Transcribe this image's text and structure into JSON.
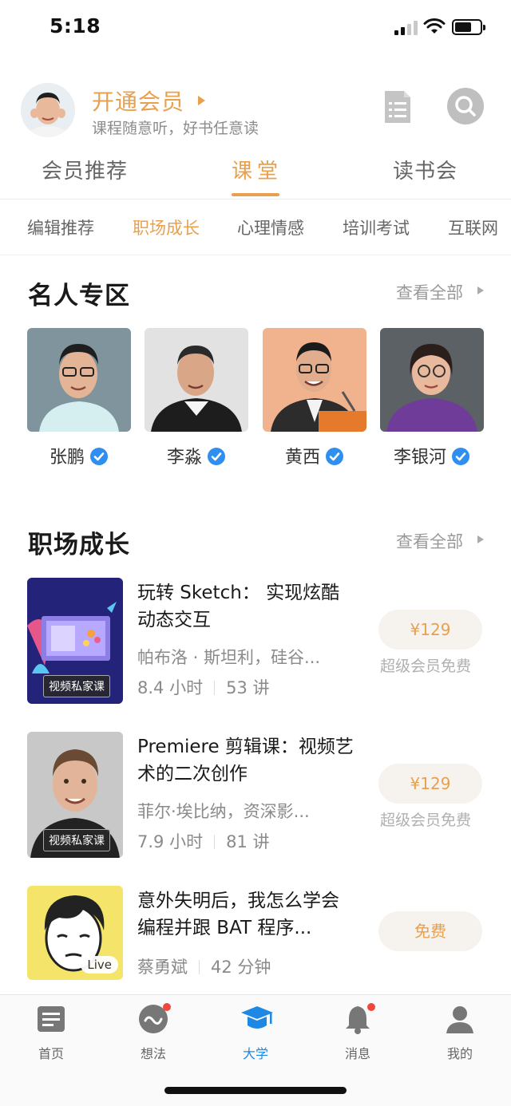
{
  "status_bar": {
    "time": "5:18"
  },
  "header": {
    "vip_title": "开通会员",
    "vip_subtitle": "课程随意听，好书任意读"
  },
  "tabs": [
    {
      "label": "会员推荐",
      "active": false
    },
    {
      "label": "课堂",
      "active": true
    },
    {
      "label": "读书会",
      "active": false
    }
  ],
  "categories": [
    {
      "label": "编辑推荐",
      "active": false
    },
    {
      "label": "职场成长",
      "active": true
    },
    {
      "label": "心理情感",
      "active": false
    },
    {
      "label": "培训考试",
      "active": false
    },
    {
      "label": "互联网",
      "active": false
    }
  ],
  "celebrity_section": {
    "title": "名人专区",
    "more": "查看全部",
    "people": [
      {
        "name": "张鹏",
        "verified": true
      },
      {
        "name": "李淼",
        "verified": true
      },
      {
        "name": "黄西",
        "verified": true
      },
      {
        "name": "李银河",
        "verified": true
      }
    ]
  },
  "career_section": {
    "title": "职场成长",
    "more": "查看全部",
    "courses": [
      {
        "title": "玩转 Sketch： 实现炫酷动态交互",
        "author": "帕布洛 · 斯坦利，硅谷...",
        "duration": "8.4 小时",
        "lessons": "53 讲",
        "tag": "视频私家课",
        "price": "¥129",
        "price_note": "超级会员免费"
      },
      {
        "title": "Premiere 剪辑课：视频艺术的二次创作",
        "author": "菲尔·埃比纳，资深影...",
        "duration": "7.9 小时",
        "lessons": "81 讲",
        "tag": "视频私家课",
        "price": "¥129",
        "price_note": "超级会员免费"
      },
      {
        "title": "意外失明后，我怎么学会编程并跟 BAT 程序...",
        "author": "蔡勇斌",
        "duration": "42 分钟",
        "tag": "Live",
        "price": "免费"
      }
    ]
  },
  "bottom_nav": [
    {
      "label": "首页",
      "icon": "home-doc-icon",
      "active": false
    },
    {
      "label": "想法",
      "icon": "ideas-icon",
      "active": false,
      "dot": true
    },
    {
      "label": "大学",
      "icon": "graduation-cap-icon",
      "active": true
    },
    {
      "label": "消息",
      "icon": "bell-icon",
      "active": false,
      "dot": true
    },
    {
      "label": "我的",
      "icon": "user-icon",
      "active": false
    }
  ],
  "colors": {
    "accent": "#e8a04e",
    "nav_active": "#1e88e5",
    "verified": "#2f8ff0"
  }
}
